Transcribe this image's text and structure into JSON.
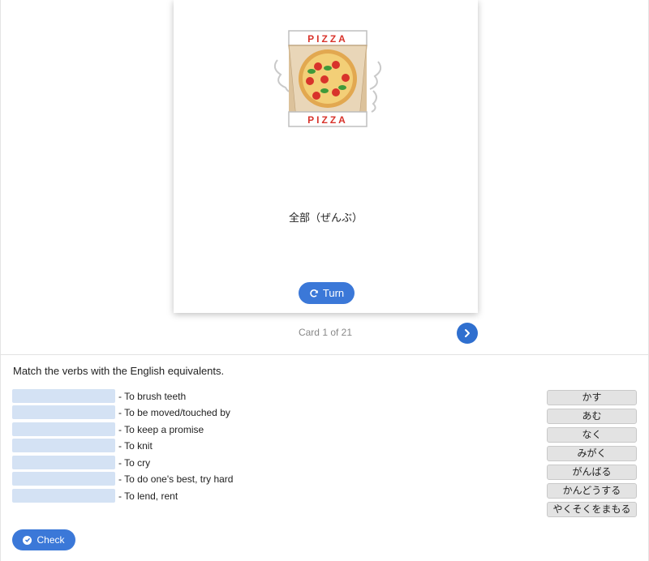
{
  "flashcard": {
    "image_text_top": "PIZZA",
    "image_text_bottom": "PIZZA",
    "word": "全部（ぜんぶ）",
    "turn_label": "Turn"
  },
  "navigation": {
    "counter": "Card 1 of 21"
  },
  "exercise": {
    "instruction": "Match the verbs with the English equivalents.",
    "rows": [
      {
        "label": "- To brush teeth"
      },
      {
        "label": "- To be moved/touched by"
      },
      {
        "label": "- To keep a promise"
      },
      {
        "label": "- To knit"
      },
      {
        "label": "- To cry"
      },
      {
        "label": "- To do one's best, try hard"
      },
      {
        "label": "- To lend, rent"
      }
    ],
    "choices": [
      "かす",
      "あむ",
      "なく",
      "みがく",
      "がんばる",
      "かんどうする",
      "やくそくをまもる"
    ],
    "check_label": "Check"
  },
  "colors": {
    "accent": "#3b78d8",
    "slot": "#d4e2f4",
    "choice_bg": "#e3e3e3"
  },
  "icons": {
    "turn": "refresh-icon",
    "next": "chevron-right-icon",
    "check": "check-circle-icon"
  }
}
